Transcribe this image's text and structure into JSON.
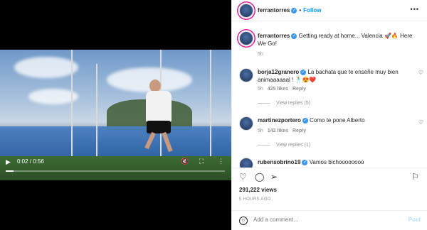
{
  "video": {
    "time": "0:02 / 0:56",
    "progress": 0.036,
    "icons": [
      "play-icon",
      "mute-icon",
      "fullscreen-icon",
      "more-vertical-icon"
    ]
  },
  "header": {
    "username": "ferrantorres",
    "follow_label": "Follow",
    "dot": "•",
    "more": "•••"
  },
  "caption": {
    "username": "ferrantorres",
    "text": "Getting ready at home... Valencia 🚀🔥 Here We Go!",
    "time": "5h"
  },
  "comments": [
    {
      "username": "borja12granero",
      "text": "La bachata que te enseñe muy bien animaaaaaal ! 🕺😍❤️",
      "time": "5h",
      "likes": "425 likes",
      "reply": "Reply",
      "view_replies": "View replies (5)"
    },
    {
      "username": "martinezportero",
      "text": "Como te pone Alberto",
      "time": "5h",
      "likes": "142 likes",
      "reply": "Reply",
      "view_replies": "View replies (1)"
    },
    {
      "username": "rubensobrino19",
      "text": "Vamos bichoooooooo"
    }
  ],
  "stats": {
    "views": "291,222 views",
    "time_ago": "5 HOURS AGO"
  },
  "add_comment": {
    "placeholder": "Add a comment…",
    "post_label": "Post"
  },
  "colors": {
    "accent": "#0095f6",
    "verified": "#3897f0"
  }
}
